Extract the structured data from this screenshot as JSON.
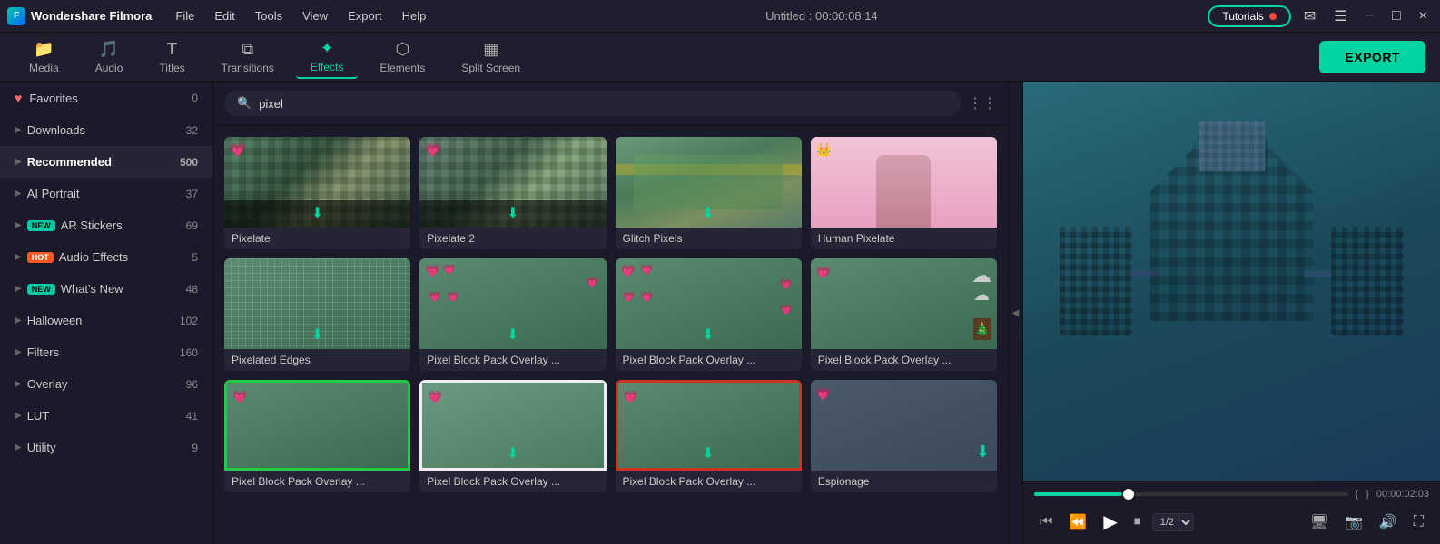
{
  "app": {
    "name": "Wondershare Filmora",
    "title": "Untitled : 00:00:08:14"
  },
  "titlebar": {
    "menu": [
      "File",
      "Edit",
      "Tools",
      "View",
      "Export",
      "Help"
    ],
    "tutorials_label": "Tutorials",
    "window_controls": [
      "−",
      "□",
      "×"
    ]
  },
  "toolbar": {
    "items": [
      {
        "id": "media",
        "icon": "📁",
        "label": "Media",
        "active": false
      },
      {
        "id": "audio",
        "icon": "🎵",
        "label": "Audio",
        "active": false
      },
      {
        "id": "titles",
        "icon": "T",
        "label": "Titles",
        "active": false
      },
      {
        "id": "transitions",
        "icon": "⧉",
        "label": "Transitions",
        "active": false
      },
      {
        "id": "effects",
        "icon": "✦",
        "label": "Effects",
        "active": true
      },
      {
        "id": "elements",
        "icon": "⬡",
        "label": "Elements",
        "active": false
      },
      {
        "id": "splitscreen",
        "icon": "▦",
        "label": "Split Screen",
        "active": false
      }
    ],
    "export_label": "EXPORT"
  },
  "sidebar": {
    "items": [
      {
        "id": "favorites",
        "label": "Favorites",
        "count": 0,
        "icon": "heart",
        "type": "heart"
      },
      {
        "id": "downloads",
        "label": "Downloads",
        "count": 32,
        "type": "expand"
      },
      {
        "id": "recommended",
        "label": "Recommended",
        "count": 500,
        "type": "active"
      },
      {
        "id": "ai-portrait",
        "label": "AI Portrait",
        "count": 37,
        "type": "expand"
      },
      {
        "id": "ar-stickers",
        "label": "AR Stickers",
        "count": 69,
        "badge": "NEW",
        "type": "expand"
      },
      {
        "id": "audio-effects",
        "label": "Audio Effects",
        "count": 5,
        "badge": "HOT",
        "type": "expand"
      },
      {
        "id": "whats-new",
        "label": "What's New",
        "count": 48,
        "badge": "NEW",
        "type": "expand"
      },
      {
        "id": "halloween",
        "label": "Halloween",
        "count": 102,
        "type": "expand"
      },
      {
        "id": "filters",
        "label": "Filters",
        "count": 160,
        "type": "expand"
      },
      {
        "id": "overlay",
        "label": "Overlay",
        "count": 96,
        "type": "expand"
      },
      {
        "id": "lut",
        "label": "LUT",
        "count": 41,
        "type": "expand"
      },
      {
        "id": "utility",
        "label": "Utility",
        "count": 9,
        "type": "expand"
      }
    ],
    "collapse_icon": "◀"
  },
  "search": {
    "placeholder": "pixel",
    "value": "pixel"
  },
  "effects": [
    {
      "id": "pixelate",
      "label": "Pixelate",
      "thumb_type": "pixelate",
      "has_heart": true,
      "has_download": true
    },
    {
      "id": "pixelate2",
      "label": "Pixelate 2",
      "thumb_type": "pixelate2",
      "has_heart": true,
      "has_download": true
    },
    {
      "id": "glitch-pixels",
      "label": "Glitch Pixels",
      "thumb_type": "glitch",
      "has_download": true
    },
    {
      "id": "human-pixelate",
      "label": "Human Pixelate",
      "thumb_type": "human",
      "has_crown": true
    },
    {
      "id": "pixelated-edges",
      "label": "Pixelated Edges",
      "thumb_type": "edges",
      "has_download": true
    },
    {
      "id": "pixel-block-1",
      "label": "Pixel Block Pack Overlay ...",
      "thumb_type": "heartgame",
      "has_heart": true,
      "has_download": true
    },
    {
      "id": "pixel-block-2",
      "label": "Pixel Block Pack Overlay ...",
      "thumb_type": "heartgame2",
      "has_heart": true,
      "has_download": true
    },
    {
      "id": "pixel-block-3",
      "label": "Pixel Block Pack Overlay ...",
      "thumb_type": "clouds",
      "has_heart": true
    },
    {
      "id": "pixel-block-4",
      "label": "Pixel Block Pack Overlay ...",
      "thumb_type": "greenframe",
      "has_heart": true
    },
    {
      "id": "pixel-block-5",
      "label": "Pixel Block Pack Overlay ...",
      "thumb_type": "whiteframe",
      "has_heart": true,
      "has_download": true
    },
    {
      "id": "pixel-block-6",
      "label": "Pixel Block Pack Overlay ...",
      "thumb_type": "redbrick",
      "has_heart": true,
      "has_download": true
    },
    {
      "id": "espionage",
      "label": "Espionage",
      "thumb_type": "espionage",
      "has_heart": true,
      "has_download": true
    }
  ],
  "preview": {
    "time_current": "00:00:02:03",
    "progress_percent": 28,
    "speed": "1/2",
    "controls": {
      "step_back": "⏮",
      "frame_back": "⏪",
      "play": "▶",
      "stop": "⏹",
      "speed_label": "1/2"
    }
  }
}
